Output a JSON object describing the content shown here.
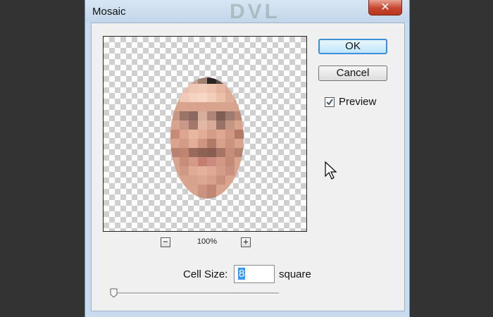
{
  "dialog": {
    "title": "Mosaic",
    "background_text": "DVL",
    "close_icon": "close-x-icon",
    "colors": {
      "frame": "#c9dcee",
      "close_button": "#c8452e",
      "ok_border": "#3c8fd6",
      "selection": "#3399ff"
    }
  },
  "preview": {
    "zoom_level": "100%",
    "zoom_out_symbol": "−",
    "zoom_in_symbol": "+"
  },
  "buttons": {
    "ok_label": "OK",
    "cancel_label": "Cancel"
  },
  "preview_toggle": {
    "label": "Preview",
    "checked": true
  },
  "cell_size": {
    "label": "Cell Size:",
    "value": "8",
    "unit": "square",
    "slider_level_fraction": 0.0
  }
}
